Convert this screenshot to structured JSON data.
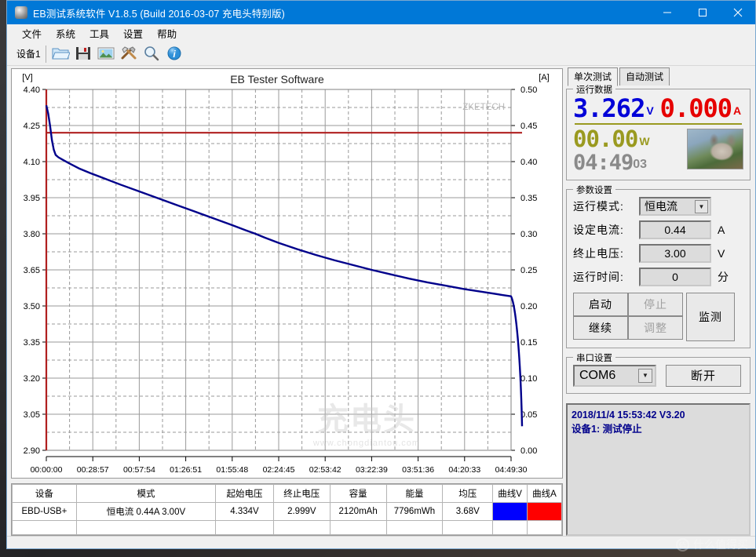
{
  "window": {
    "title": "EB测试系统软件 V1.8.5 (Build 2016-03-07 充电头特别版)",
    "minimize": "—",
    "maximize": "□",
    "close": "✕"
  },
  "menu": {
    "items": [
      "文件",
      "系统",
      "工具",
      "设置",
      "帮助"
    ]
  },
  "toolbar": {
    "device_tab": "设备1",
    "icons": [
      "open-folder-icon",
      "save-disk-icon",
      "image-icon",
      "tools-icon",
      "zoom-icon",
      "info-icon"
    ]
  },
  "right_panel": {
    "tabs": [
      {
        "label": "单次测试",
        "active": true
      },
      {
        "label": "自动测试",
        "active": false
      }
    ],
    "run_data": {
      "legend": "运行数据",
      "voltage": "3.262",
      "voltage_unit": "V",
      "current": "0.000",
      "current_unit": "A",
      "power": "00.00",
      "power_unit": "W",
      "time": "04:49",
      "time_seconds": "03",
      "photo": "cat-photo"
    },
    "params": {
      "legend": "参数设置",
      "rows": [
        {
          "label": "运行模式:",
          "value": "恒电流",
          "unit": "",
          "type": "select"
        },
        {
          "label": "设定电流:",
          "value": "0.44",
          "unit": "A",
          "type": "text"
        },
        {
          "label": "终止电压:",
          "value": "3.00",
          "unit": "V",
          "type": "text"
        },
        {
          "label": "运行时间:",
          "value": "0",
          "unit": "分",
          "type": "text"
        }
      ],
      "buttons": {
        "start": "启动",
        "stop": "停止",
        "resume": "继续",
        "adjust": "调整",
        "monitor": "监测"
      }
    },
    "serial": {
      "legend": "串口设置",
      "port": "COM6",
      "disconnect": "断开"
    },
    "log": {
      "line1": "2018/11/4 15:53:42  V3.20",
      "line2": "设备1: 测试停止"
    }
  },
  "results_table": {
    "headers": [
      "设备",
      "模式",
      "起始电压",
      "终止电压",
      "容量",
      "能量",
      "均压",
      "曲线V",
      "曲线A"
    ],
    "rows": [
      {
        "device": "EBD-USB+",
        "mode": "恒电流  0.44A  3.00V",
        "start_voltage": "4.334V",
        "end_voltage": "2.999V",
        "capacity": "2120mAh",
        "energy": "7796mWh",
        "avg_voltage": "3.68V",
        "curve_v_color": "#0000ff",
        "curve_a_color": "#ff0000"
      }
    ]
  },
  "watermarks": {
    "chart_brand": "ZKETECH",
    "center_cn": "充电头",
    "center_url": "www.chongdiantou.com",
    "corner_badge": "什么值得买",
    "corner_badge_icon": "值"
  },
  "chart_data": {
    "type": "line",
    "title": "EB Tester Software",
    "xlabel": "",
    "ylabel": "[V]",
    "y2label": "[A]",
    "ylim": [
      2.9,
      4.4
    ],
    "y2lim": [
      0.0,
      0.5
    ],
    "grid": true,
    "y_ticks": [
      "4.40",
      "4.25",
      "4.10",
      "3.95",
      "3.80",
      "3.65",
      "3.50",
      "3.35",
      "3.20",
      "3.05",
      "2.90"
    ],
    "y2_ticks": [
      "0.50",
      "0.45",
      "0.40",
      "0.35",
      "0.30",
      "0.25",
      "0.20",
      "0.15",
      "0.10",
      "0.05",
      "0.00"
    ],
    "x_ticks": [
      "00:00:00",
      "00:28:57",
      "00:57:54",
      "01:26:51",
      "01:55:48",
      "02:24:45",
      "02:53:42",
      "03:22:39",
      "03:51:36",
      "04:20:33",
      "04:49:30"
    ],
    "x_range_seconds": [
      0,
      17370
    ],
    "series": [
      {
        "name": "曲线V",
        "color": "#00008b",
        "axis": "left",
        "unit": "V",
        "points": [
          [
            0.0,
            4.334
          ],
          [
            0.004,
            4.3
          ],
          [
            0.008,
            4.25
          ],
          [
            0.012,
            4.19
          ],
          [
            0.016,
            4.15
          ],
          [
            0.02,
            4.128
          ],
          [
            0.026,
            4.118
          ],
          [
            0.035,
            4.108
          ],
          [
            0.05,
            4.092
          ],
          [
            0.07,
            4.072
          ],
          [
            0.095,
            4.052
          ],
          [
            0.125,
            4.03
          ],
          [
            0.16,
            4.004
          ],
          [
            0.2,
            3.976
          ],
          [
            0.24,
            3.948
          ],
          [
            0.28,
            3.92
          ],
          [
            0.32,
            3.892
          ],
          [
            0.36,
            3.864
          ],
          [
            0.4,
            3.836
          ],
          [
            0.43,
            3.814
          ],
          [
            0.45,
            3.8
          ],
          [
            0.47,
            3.784
          ],
          [
            0.5,
            3.762
          ],
          [
            0.54,
            3.736
          ],
          [
            0.58,
            3.712
          ],
          [
            0.62,
            3.69
          ],
          [
            0.66,
            3.67
          ],
          [
            0.7,
            3.65
          ],
          [
            0.74,
            3.632
          ],
          [
            0.78,
            3.614
          ],
          [
            0.82,
            3.598
          ],
          [
            0.86,
            3.584
          ],
          [
            0.9,
            3.57
          ],
          [
            0.94,
            3.558
          ],
          [
            0.98,
            3.546
          ],
          [
            1.0,
            3.54
          ]
        ],
        "note": "x normalized 0-1 over full test duration 04:49:30"
      },
      {
        "name": "曲线A",
        "color": "#b02020",
        "axis": "right",
        "unit": "A",
        "value": 0.44,
        "points": [
          [
            0.0,
            0.44
          ],
          [
            1.0,
            0.44
          ]
        ],
        "note": "constant current 0.44A flat line plus vertical drop at start/end"
      }
    ]
  }
}
